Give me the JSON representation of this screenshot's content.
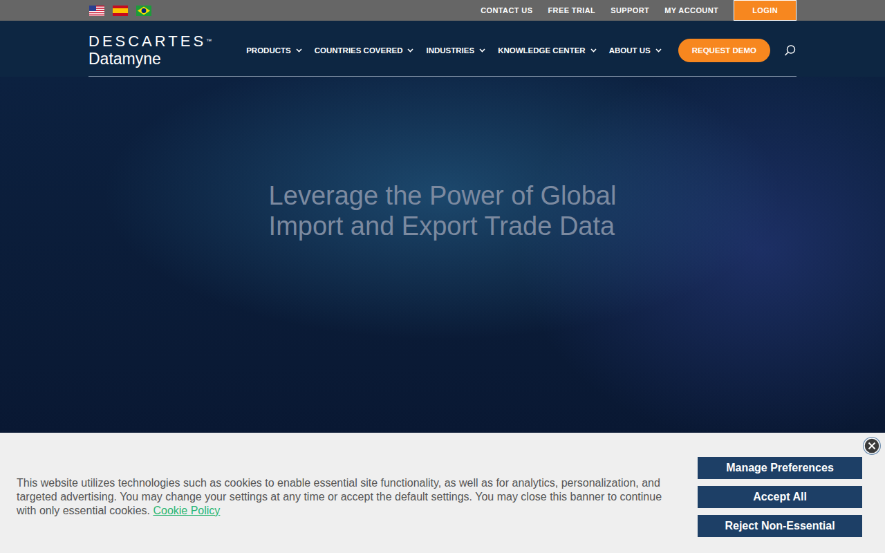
{
  "top_bar": {
    "links": [
      "CONTACT US",
      "FREE TRIAL",
      "SUPPORT",
      "MY ACCOUNT"
    ],
    "login_button": "LOGIN"
  },
  "logo": {
    "brand": "DESCARTES",
    "trademark": "™",
    "product": "Datamyne"
  },
  "nav": {
    "items": [
      "PRODUCTS",
      "COUNTRIES COVERED",
      "INDUSTRIES",
      "KNOWLEDGE CENTER",
      "ABOUT US"
    ],
    "request_demo": "REQUEST DEMO"
  },
  "hero": {
    "title_lines": [
      "Leverage the Power of Global",
      "Import and Export Trade Data"
    ]
  },
  "cookie_banner": {
    "text": "This website utilizes technologies such as cookies to enable essential site functionality, as well as for analytics, personalization, and targeted advertising. You may change your settings at any time or accept the default settings. You may close this banner to continue with only essential cookies.",
    "link": "Cookie Policy",
    "buttons": [
      "Manage Preferences",
      "Accept All",
      "Reject Non-Essential"
    ]
  }
}
